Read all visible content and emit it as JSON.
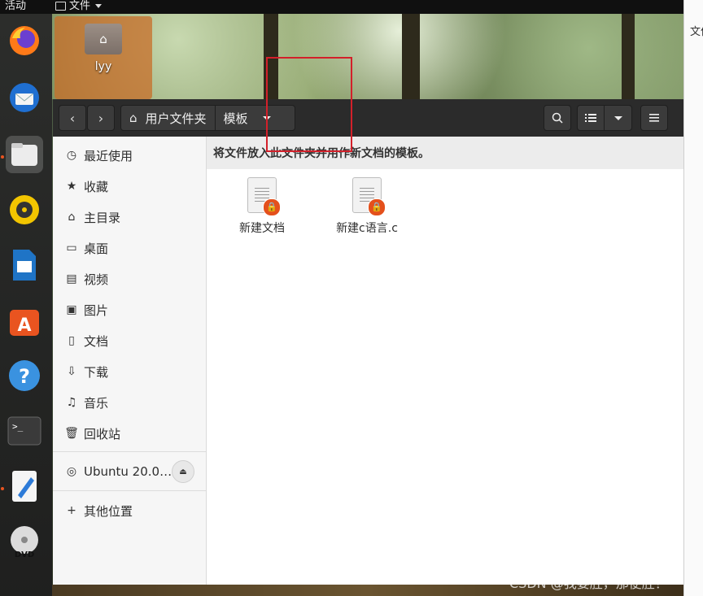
{
  "topbar": {
    "activities": "活动",
    "app_menu": "文件"
  },
  "desktop": {
    "home_icon_label": "lyy"
  },
  "right_window": {
    "text": "文件"
  },
  "window": {
    "path": {
      "home": "用户文件夹",
      "current": "模板"
    },
    "notice": "将文件放入此文件夹并用作新文档的模板。",
    "files": [
      {
        "name": "新建文档"
      },
      {
        "name": "新建c语言.c"
      }
    ]
  },
  "sidebar": {
    "items": [
      {
        "label": "最近使用",
        "icon": "clock-icon"
      },
      {
        "label": "收藏",
        "icon": "star-icon"
      },
      {
        "label": "主目录",
        "icon": "home-icon"
      },
      {
        "label": "桌面",
        "icon": "desktop-icon"
      },
      {
        "label": "视频",
        "icon": "video-icon"
      },
      {
        "label": "图片",
        "icon": "picture-icon"
      },
      {
        "label": "文档",
        "icon": "document-icon"
      },
      {
        "label": "下载",
        "icon": "download-icon"
      },
      {
        "label": "音乐",
        "icon": "music-icon"
      },
      {
        "label": "回收站",
        "icon": "trash-icon"
      }
    ],
    "drive": {
      "label": "Ubuntu 20.0…"
    },
    "other_locations": {
      "label": "其他位置"
    }
  },
  "watermark": "CSDN @我要胜，那便胜！",
  "colors": {
    "accent": "#e95420",
    "highlight_box": "#d3202a",
    "headerbar": "#2b2b2b"
  }
}
